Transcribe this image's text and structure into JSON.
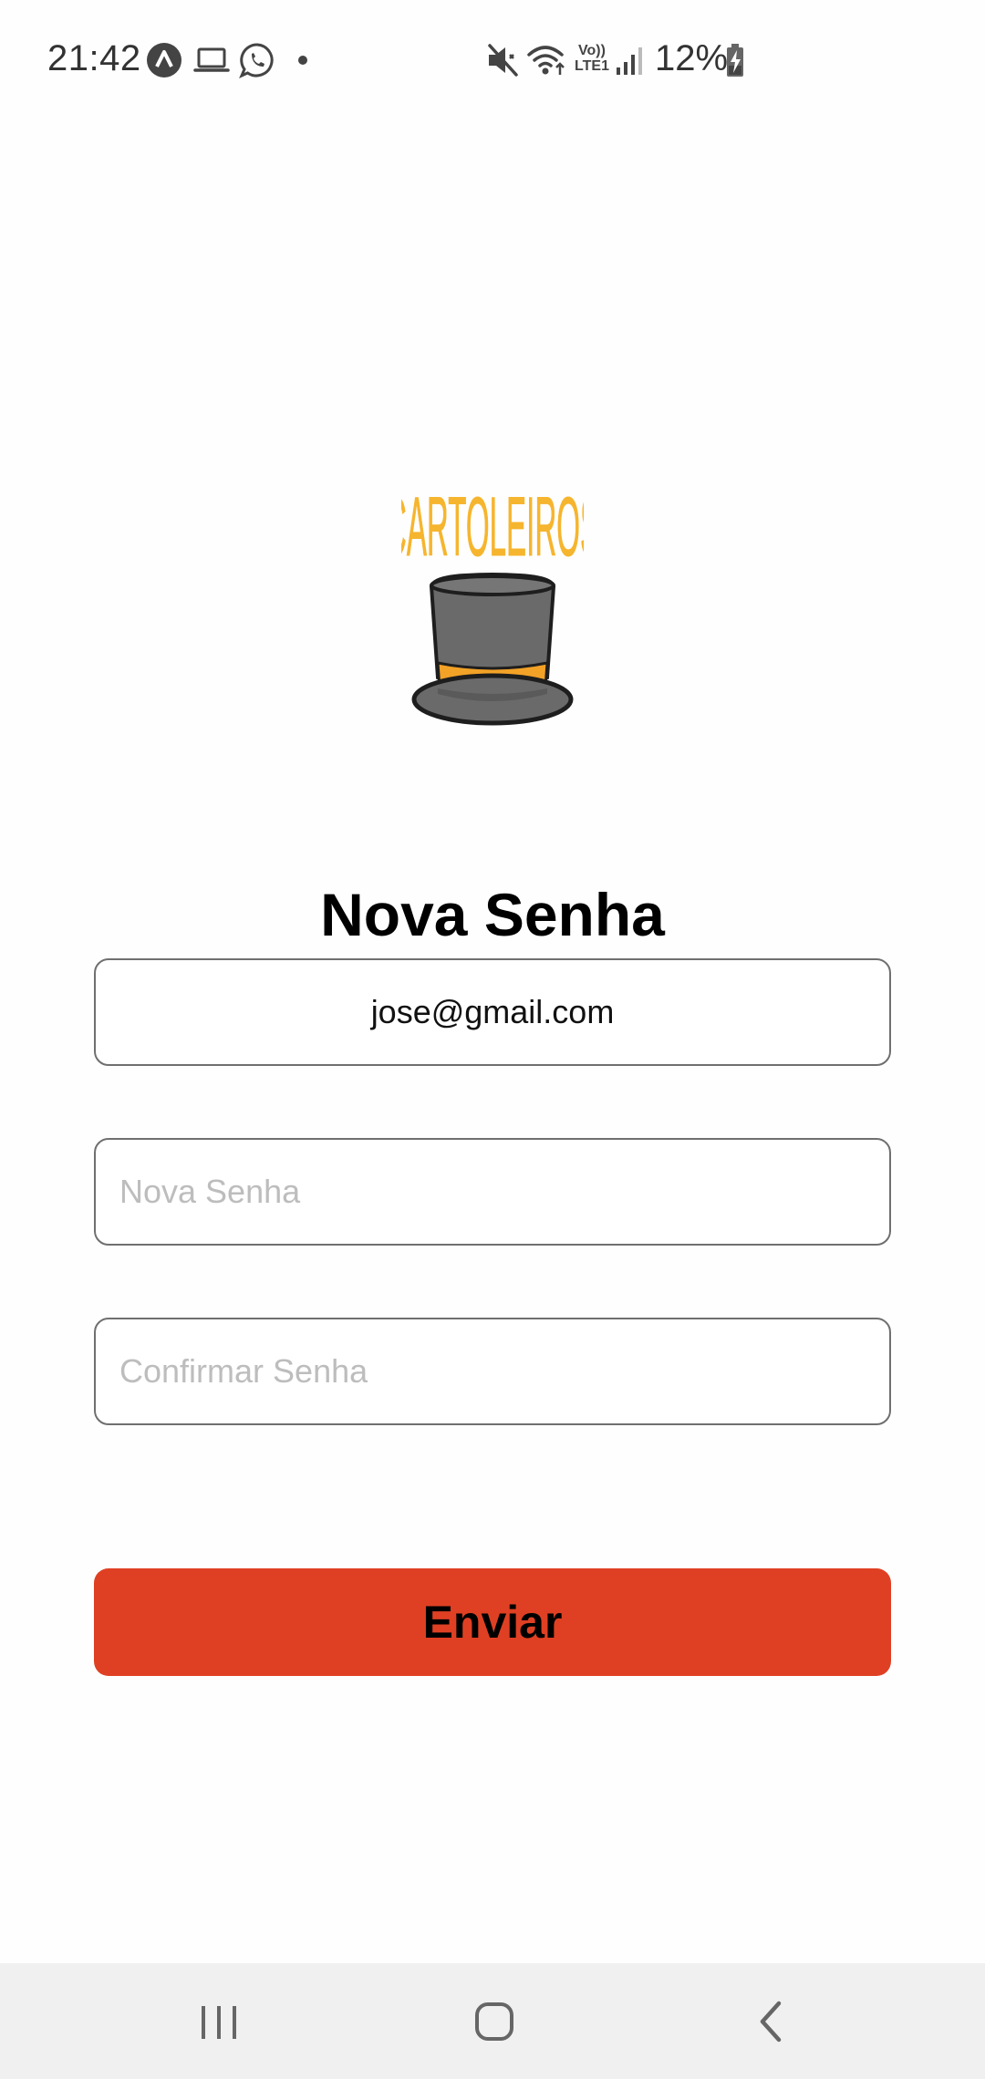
{
  "status_bar": {
    "time": "21:42",
    "battery_percent": "12%",
    "network_label_top": "Vo))",
    "network_label_bottom": "LTE1",
    "icons": [
      "autopilot-icon",
      "laptop-icon",
      "whatsapp-icon",
      "dot-icon",
      "mute-vibrate-icon",
      "wifi-icon",
      "volte-icon",
      "signal-icon",
      "battery-charging-icon"
    ]
  },
  "logo": {
    "wordmark": "CARTOLEIROS",
    "icon": "top-hat-icon",
    "colors": {
      "wordmark": "#f6b52e",
      "hat": "#6a6a6a",
      "band": "#f2a227",
      "outline": "#1e1e1e"
    }
  },
  "form": {
    "title": "Nova Senha",
    "email_value": "jose@gmail.com",
    "password_placeholder": "Nova Senha",
    "confirm_placeholder": "Confirmar Senha",
    "submit_label": "Enviar"
  },
  "nav_bar": {
    "buttons": [
      "recent-apps-icon",
      "home-icon",
      "back-icon"
    ]
  },
  "colors": {
    "accent": "#df4023",
    "background": "#fefefe",
    "nav_background": "#f0f0f0"
  }
}
